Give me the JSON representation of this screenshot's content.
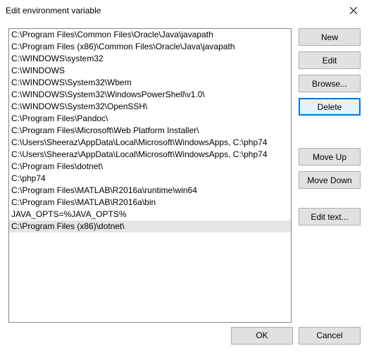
{
  "window": {
    "title": "Edit environment variable"
  },
  "list": {
    "selected_index": 16,
    "items": [
      "C:\\Program Files\\Common Files\\Oracle\\Java\\javapath",
      "C:\\Program Files (x86)\\Common Files\\Oracle\\Java\\javapath",
      "C:\\WINDOWS\\system32",
      "C:\\WINDOWS",
      "C:\\WINDOWS\\System32\\Wbem",
      "C:\\WINDOWS\\System32\\WindowsPowerShell\\v1.0\\",
      "C:\\WINDOWS\\System32\\OpenSSH\\",
      "C:\\Program Files\\Pandoc\\",
      "C:\\Program Files\\Microsoft\\Web Platform Installer\\",
      "C:\\Users\\Sheeraz\\AppData\\Local\\Microsoft\\WindowsApps, C:\\php74",
      "C:\\Users\\Sheeraz\\AppData\\Local\\Microsoft\\WindowsApps, C:\\php74",
      "C:\\Program Files\\dotnet\\",
      "C:\\php74",
      "C:\\Program Files\\MATLAB\\R2016a\\runtime\\win64",
      "C:\\Program Files\\MATLAB\\R2016a\\bin",
      "JAVA_OPTS=%JAVA_OPTS%",
      "C:\\Program Files (x86)\\dotnet\\"
    ]
  },
  "buttons": {
    "new": "New",
    "edit": "Edit",
    "browse": "Browse...",
    "delete": "Delete",
    "move_up": "Move Up",
    "move_down": "Move Down",
    "edit_text": "Edit text...",
    "ok": "OK",
    "cancel": "Cancel"
  }
}
